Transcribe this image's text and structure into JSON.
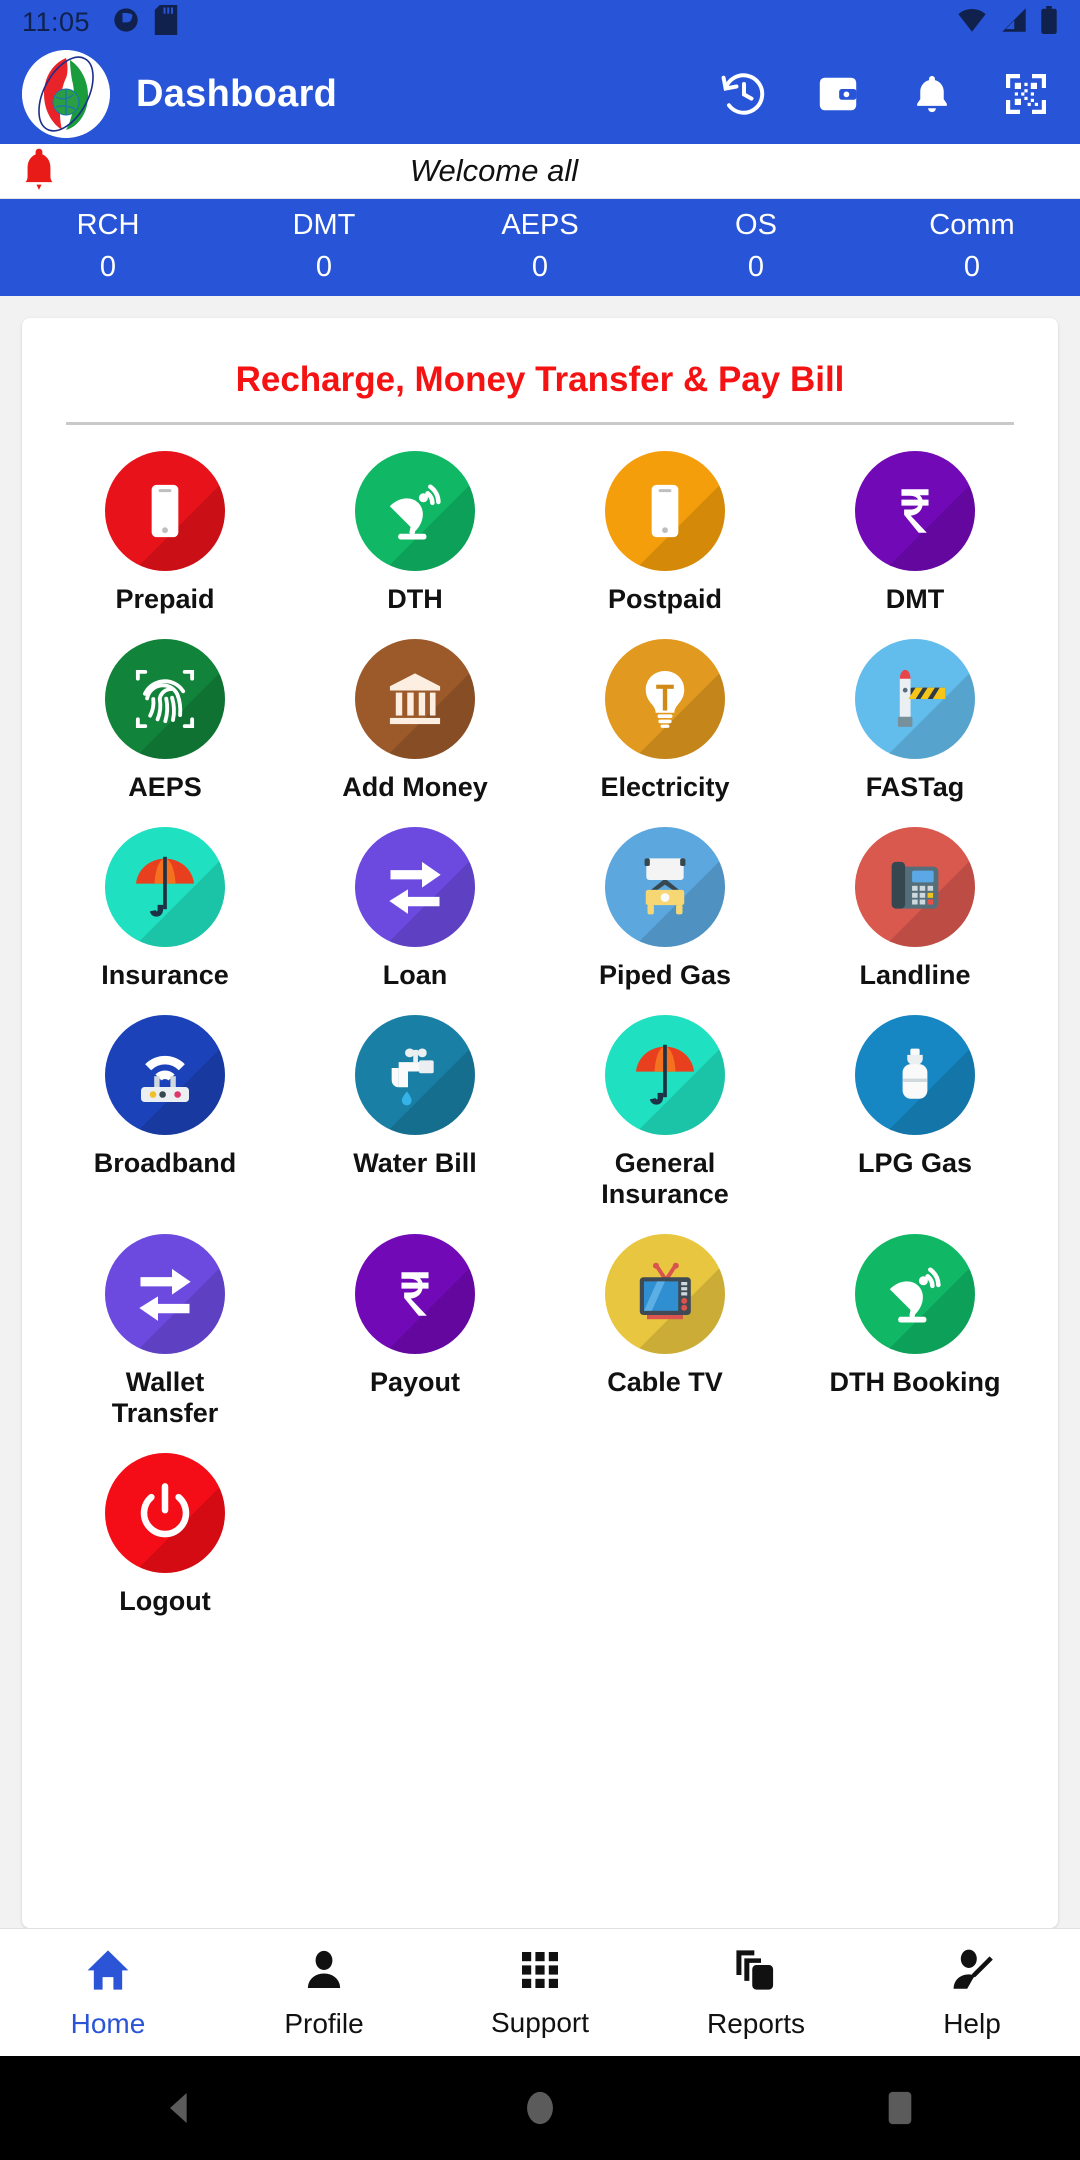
{
  "statusbar": {
    "time": "11:05",
    "left_icons": [
      "do-not-disturb-icon",
      "sd-card-icon"
    ],
    "right_icons": [
      "wifi-icon",
      "signal-icon",
      "battery-icon"
    ]
  },
  "appbar": {
    "logo": "app-logo",
    "title": "Dashboard",
    "actions": [
      {
        "name": "history-icon",
        "label": "History"
      },
      {
        "name": "wallet-icon",
        "label": "Wallet"
      },
      {
        "name": "notification-bell-icon",
        "label": "Notifications"
      },
      {
        "name": "qr-scan-icon",
        "label": "Scan QR"
      }
    ]
  },
  "welcome": {
    "bell_icon": "announcement-bell-icon",
    "text": "Welcome all"
  },
  "stats": [
    {
      "label": "RCH",
      "value": "0"
    },
    {
      "label": "DMT",
      "value": "0"
    },
    {
      "label": "AEPS",
      "value": "0"
    },
    {
      "label": "OS",
      "value": "0"
    },
    {
      "label": "Comm",
      "value": "0"
    }
  ],
  "card": {
    "title": "Recharge, Money Transfer & Pay Bill",
    "title_color": "#f41212"
  },
  "services": [
    {
      "label": "Prepaid",
      "icon": "mobile-phone-icon",
      "bg": "#e8131a"
    },
    {
      "label": "DTH",
      "icon": "satellite-dish-icon",
      "bg": "#10b866"
    },
    {
      "label": "Postpaid",
      "icon": "mobile-phone-icon",
      "bg": "#f59e0b"
    },
    {
      "label": "DMT",
      "icon": "rupee-icon",
      "bg": "#7209b7"
    },
    {
      "label": "AEPS",
      "icon": "fingerprint-icon",
      "bg": "#12833a"
    },
    {
      "label": "Add Money",
      "icon": "bank-icon",
      "bg": "#9c5a2b"
    },
    {
      "label": "Electricity",
      "icon": "light-bulb-icon",
      "bg": "#e2991f"
    },
    {
      "label": "FASTag",
      "icon": "toll-barrier-icon",
      "bg": "#63bdec"
    },
    {
      "label": "Insurance",
      "icon": "umbrella-icon",
      "bg": "#1fe0c0"
    },
    {
      "label": "Loan",
      "icon": "transfer-arrows-icon",
      "bg": "#6c4ae0"
    },
    {
      "label": "Piped Gas",
      "icon": "gas-stove-icon",
      "bg": "#5ba7de"
    },
    {
      "label": "Landline",
      "icon": "landline-phone-icon",
      "bg": "#d9594f"
    },
    {
      "label": "Broadband",
      "icon": "wifi-router-icon",
      "bg": "#1b42b8"
    },
    {
      "label": "Water Bill",
      "icon": "water-tap-icon",
      "bg": "#1a7fa5"
    },
    {
      "label": "General Insurance",
      "icon": "umbrella-icon",
      "bg": "#1fe0c0"
    },
    {
      "label": "LPG Gas",
      "icon": "gas-cylinder-icon",
      "bg": "#1687c2"
    },
    {
      "label": "Wallet Transfer",
      "icon": "transfer-arrows-icon",
      "bg": "#6c4ae0"
    },
    {
      "label": "Payout",
      "icon": "rupee-icon",
      "bg": "#7209b7"
    },
    {
      "label": "Cable TV",
      "icon": "television-icon",
      "bg": "#ecc councils"
    },
    {
      "label": "DTH Booking",
      "icon": "satellite-dish-icon",
      "bg": "#10b866"
    },
    {
      "label": "Logout",
      "icon": "power-off-icon",
      "bg": "#f40d16"
    }
  ],
  "bottomnav": {
    "active": "Home",
    "items": [
      {
        "label": "Home",
        "icon": "home-icon"
      },
      {
        "label": "Profile",
        "icon": "person-icon"
      },
      {
        "label": "Support",
        "icon": "grid-dots-icon"
      },
      {
        "label": "Reports",
        "icon": "copy-documents-icon"
      },
      {
        "label": "Help",
        "icon": "person-edit-icon"
      }
    ]
  },
  "androidnav": {
    "items": [
      {
        "name": "android-back-button"
      },
      {
        "name": "android-home-button"
      },
      {
        "name": "android-recents-button"
      }
    ]
  },
  "colors": {
    "primary": "#2855d8",
    "accent_red": "#f41212",
    "nav_active": "#2b55d6"
  }
}
